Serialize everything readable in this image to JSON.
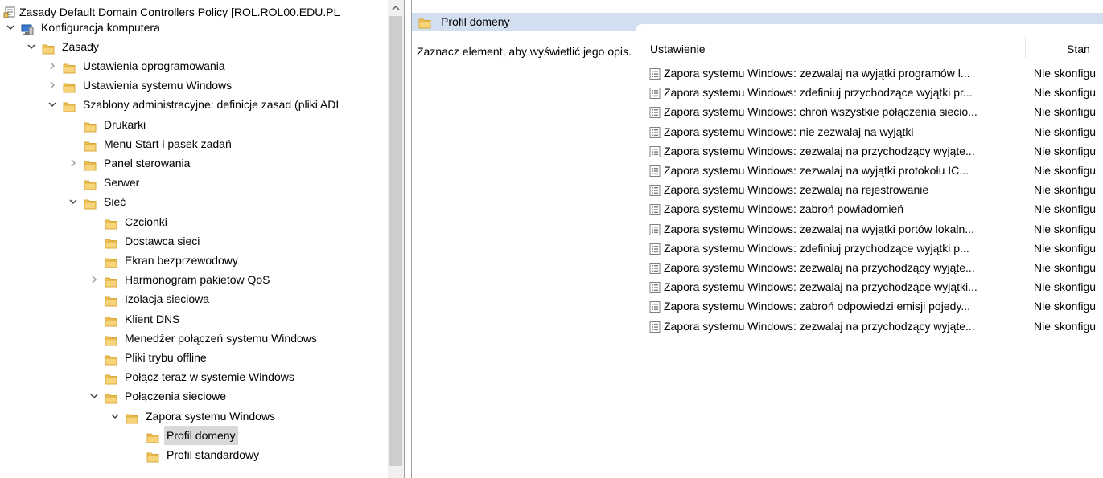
{
  "tree": {
    "root": "Zasady Default Domain Controllers Policy [ROL.ROL00.EDU.PL",
    "items": [
      {
        "label": "Konfiguracja komputera",
        "level": 1,
        "expand": "expanded",
        "icon": "computer-icon"
      },
      {
        "label": "Zasady",
        "level": 2,
        "expand": "expanded",
        "icon": "folder-icon"
      },
      {
        "label": "Ustawienia oprogramowania",
        "level": 3,
        "expand": "collapsed",
        "icon": "folder-icon"
      },
      {
        "label": "Ustawienia systemu Windows",
        "level": 3,
        "expand": "collapsed",
        "icon": "folder-icon"
      },
      {
        "label": "Szablony administracyjne: definicje zasad (pliki ADI",
        "level": 3,
        "expand": "expanded",
        "icon": "folder-icon"
      },
      {
        "label": "Drukarki",
        "level": 4,
        "expand": "none",
        "icon": "folder-icon"
      },
      {
        "label": "Menu Start i pasek zadań",
        "level": 4,
        "expand": "none",
        "icon": "folder-icon"
      },
      {
        "label": "Panel sterowania",
        "level": 4,
        "expand": "collapsed",
        "icon": "folder-icon"
      },
      {
        "label": "Serwer",
        "level": 4,
        "expand": "none",
        "icon": "folder-icon"
      },
      {
        "label": "Sieć",
        "level": 4,
        "expand": "expanded",
        "icon": "folder-icon"
      },
      {
        "label": "Czcionki",
        "level": 5,
        "expand": "none",
        "icon": "folder-icon"
      },
      {
        "label": "Dostawca sieci",
        "level": 5,
        "expand": "none",
        "icon": "folder-icon"
      },
      {
        "label": "Ekran bezprzewodowy",
        "level": 5,
        "expand": "none",
        "icon": "folder-icon"
      },
      {
        "label": "Harmonogram pakietów QoS",
        "level": 5,
        "expand": "collapsed",
        "icon": "folder-icon"
      },
      {
        "label": "Izolacja sieciowa",
        "level": 5,
        "expand": "none",
        "icon": "folder-icon"
      },
      {
        "label": "Klient DNS",
        "level": 5,
        "expand": "none",
        "icon": "folder-icon"
      },
      {
        "label": "Menedżer połączeń systemu Windows",
        "level": 5,
        "expand": "none",
        "icon": "folder-icon"
      },
      {
        "label": "Pliki trybu offline",
        "level": 5,
        "expand": "none",
        "icon": "folder-icon"
      },
      {
        "label": "Połącz teraz w systemie Windows",
        "level": 5,
        "expand": "none",
        "icon": "folder-icon"
      },
      {
        "label": "Połączenia sieciowe",
        "level": 5,
        "expand": "expanded",
        "icon": "folder-icon"
      },
      {
        "label": "Zapora systemu Windows",
        "level": 6,
        "expand": "expanded",
        "icon": "folder-icon"
      },
      {
        "label": "Profil domeny",
        "level": 7,
        "expand": "none",
        "icon": "folder-icon",
        "selected": true
      },
      {
        "label": "Profil standardowy",
        "level": 7,
        "expand": "none",
        "icon": "folder-icon"
      }
    ]
  },
  "details": {
    "title": "Profil domeny",
    "description": "Zaznacz element, aby wyświetlić jego opis.",
    "columns": {
      "setting": "Ustawienie",
      "state": "Stan"
    },
    "rows": [
      {
        "setting": "Zapora systemu Windows: zezwalaj na wyjątki programów l...",
        "state": "Nie skonfigu"
      },
      {
        "setting": "Zapora systemu Windows: zdefiniuj przychodzące wyjątki pr...",
        "state": "Nie skonfigu"
      },
      {
        "setting": "Zapora systemu Windows: chroń wszystkie połączenia siecio...",
        "state": "Nie skonfigu"
      },
      {
        "setting": "Zapora systemu Windows: nie zezwalaj na wyjątki",
        "state": "Nie skonfigu"
      },
      {
        "setting": "Zapora systemu Windows: zezwalaj na przychodzący wyjąte...",
        "state": "Nie skonfigu"
      },
      {
        "setting": "Zapora systemu Windows: zezwalaj na wyjątki protokołu IC...",
        "state": "Nie skonfigu"
      },
      {
        "setting": "Zapora systemu Windows: zezwalaj na rejestrowanie",
        "state": "Nie skonfigu"
      },
      {
        "setting": "Zapora systemu Windows: zabroń powiadomień",
        "state": "Nie skonfigu"
      },
      {
        "setting": "Zapora systemu Windows: zezwalaj na wyjątki portów lokaln...",
        "state": "Nie skonfigu"
      },
      {
        "setting": "Zapora systemu Windows: zdefiniuj przychodzące wyjątki p...",
        "state": "Nie skonfigu"
      },
      {
        "setting": "Zapora systemu Windows: zezwalaj na przychodzący wyjąte...",
        "state": "Nie skonfigu"
      },
      {
        "setting": "Zapora systemu Windows: zezwalaj na przychodzące wyjątki...",
        "state": "Nie skonfigu"
      },
      {
        "setting": "Zapora systemu Windows: zabroń odpowiedzi emisji pojedy...",
        "state": "Nie skonfigu"
      },
      {
        "setting": "Zapora systemu Windows: zezwalaj na przychodzący wyjąte...",
        "state": "Nie skonfigu"
      }
    ]
  },
  "colors": {
    "folder": "#f0c45a",
    "folderDark": "#d9a83a",
    "selected": "#d9d9d9",
    "headerBar": "#d2dff0"
  }
}
